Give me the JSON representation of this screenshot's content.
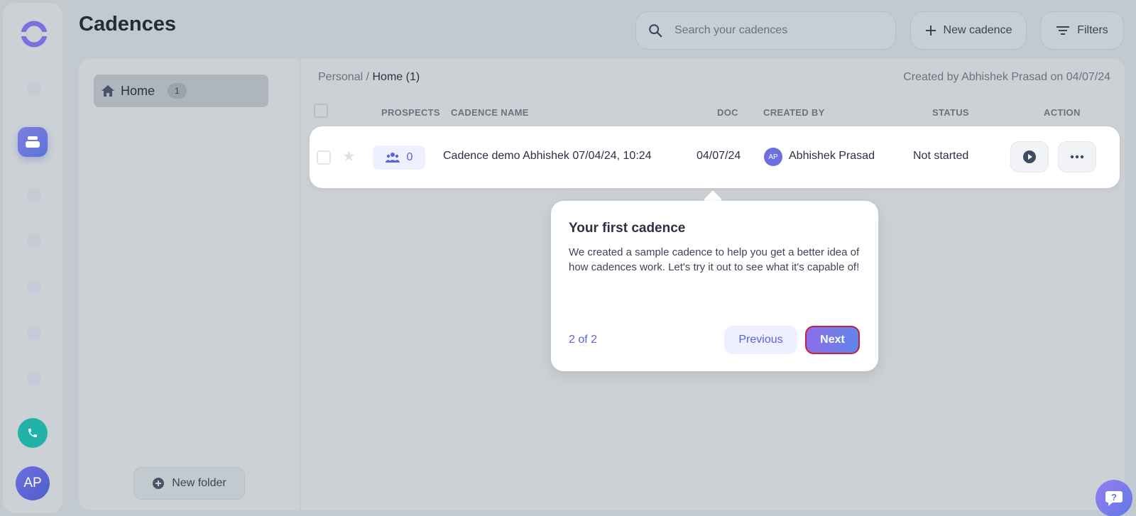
{
  "header": {
    "title": "Cadences",
    "search_placeholder": "Search your cadences",
    "new_cadence_label": "New cadence",
    "filters_label": "Filters"
  },
  "sidebar": {
    "avatar_initials": "AP"
  },
  "folders": {
    "home_label": "Home",
    "home_count": "1",
    "new_folder_label": "New folder"
  },
  "breadcrumb": {
    "parent": "Personal",
    "separator": " / ",
    "current": "Home (1)"
  },
  "created_by_note": "Created by Abhishek Prasad on 04/07/24",
  "table": {
    "columns": [
      "PROSPECTS",
      "CADENCE NAME",
      "DOC",
      "CREATED BY",
      "STATUS",
      "ACTION"
    ],
    "rows": [
      {
        "prospects": "0",
        "name": "Cadence demo Abhishek 07/04/24, 10:24",
        "doc": "04/07/24",
        "creator_initials": "AP",
        "creator": "Abhishek Prasad",
        "status": "Not started"
      }
    ]
  },
  "tour": {
    "title": "Your first cadence",
    "body": "We created a sample cadence to help you get a better idea of how cadences work. Let's try it out to see what it's capable of!",
    "step": "2 of 2",
    "previous_label": "Previous",
    "next_label": "Next"
  },
  "colors": {
    "accent": "#5a63d8",
    "next_border": "#c4213c",
    "phone": "#22b3a8"
  }
}
